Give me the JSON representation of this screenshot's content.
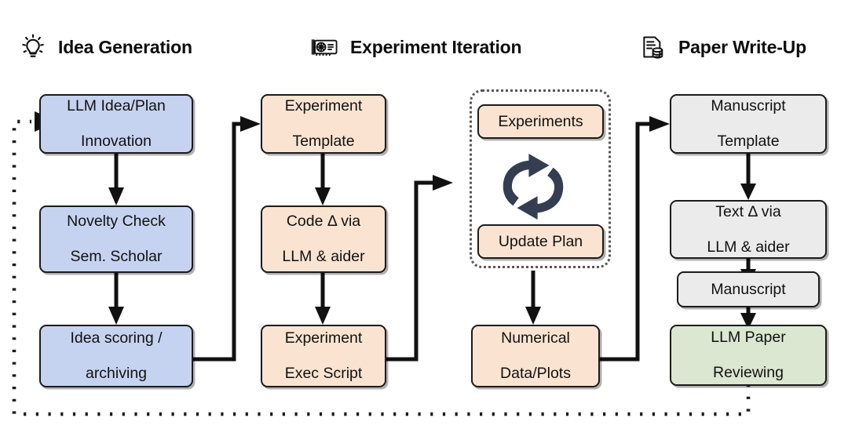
{
  "diagram": {
    "title": "AI Scientist pipeline",
    "type": "flowchart",
    "palette": {
      "blue": "#c6d3f0",
      "peach": "#fae4d1",
      "grey": "#ebebeb",
      "green": "#dbe7d1",
      "stroke": "#1b1b1b",
      "loop_icon": "#353d52",
      "dotted": "#555555"
    }
  },
  "headers": [
    {
      "id": "idea-generation",
      "label": "Idea Generation",
      "icon": "lightbulb-icon"
    },
    {
      "id": "experiment-iteration",
      "label": "Experiment Iteration",
      "icon": "gpu-card-icon"
    },
    {
      "id": "paper-write-up",
      "label": "Paper Write-Up",
      "icon": "document-database-icon"
    }
  ],
  "columns": [
    {
      "id": "idea-generation",
      "color": "blue",
      "nodes": [
        {
          "id": "llm-idea-plan",
          "line1": "LLM Idea/Plan",
          "line2": "Innovation"
        },
        {
          "id": "novelty-check",
          "line1": "Novelty Check",
          "line2": "Sem. Scholar"
        },
        {
          "id": "idea-scoring",
          "line1": "Idea scoring /",
          "line2": "archiving"
        }
      ]
    },
    {
      "id": "experiment-setup",
      "color": "peach",
      "nodes": [
        {
          "id": "experiment-template",
          "line1": "Experiment",
          "line2": "Template"
        },
        {
          "id": "code-delta",
          "line1": "Code Δ via",
          "line2": "LLM & aider"
        },
        {
          "id": "experiment-exec-script",
          "line1": "Experiment",
          "line2": "Exec Script"
        }
      ]
    },
    {
      "id": "experiment-loop",
      "color": "peach",
      "nodes": [
        {
          "id": "experiments",
          "line1": "Experiments",
          "line2": ""
        },
        {
          "id": "update-plan",
          "line1": "Update Plan",
          "line2": ""
        },
        {
          "id": "numerical-data-plots",
          "line1": "Numerical",
          "line2": "Data/Plots"
        }
      ],
      "loop_icon": "refresh-cycle-icon"
    },
    {
      "id": "paper-write-up",
      "color": "grey",
      "nodes": [
        {
          "id": "manuscript-template",
          "line1": "Manuscript",
          "line2": "Template",
          "color": "grey"
        },
        {
          "id": "text-delta",
          "line1": "Text Δ via",
          "line2": "LLM & aider",
          "color": "grey"
        },
        {
          "id": "manuscript",
          "line1": "Manuscript",
          "line2": "",
          "color": "grey"
        },
        {
          "id": "llm-paper-reviewing",
          "line1": "LLM Paper",
          "line2": "Reviewing",
          "color": "green"
        }
      ]
    }
  ],
  "connections": [
    {
      "from": "feedback-loop",
      "to": "llm-idea-plan",
      "style": "dotted-arrow"
    },
    {
      "from": "llm-idea-plan",
      "to": "novelty-check",
      "style": "arrow"
    },
    {
      "from": "novelty-check",
      "to": "idea-scoring",
      "style": "arrow"
    },
    {
      "from": "idea-scoring",
      "to": "experiment-template",
      "style": "elbow-arrow"
    },
    {
      "from": "experiment-template",
      "to": "code-delta",
      "style": "arrow"
    },
    {
      "from": "code-delta",
      "to": "experiment-exec-script",
      "style": "arrow"
    },
    {
      "from": "experiment-exec-script",
      "to": "experiment-loop",
      "style": "elbow-arrow"
    },
    {
      "from": "experiment-loop",
      "to": "numerical-data-plots",
      "style": "arrow"
    },
    {
      "from": "numerical-data-plots",
      "to": "manuscript-template",
      "style": "elbow-arrow"
    },
    {
      "from": "manuscript-template",
      "to": "text-delta",
      "style": "arrow"
    },
    {
      "from": "text-delta",
      "to": "manuscript",
      "style": "arrow"
    },
    {
      "from": "manuscript",
      "to": "llm-paper-reviewing",
      "style": "arrow"
    },
    {
      "from": "llm-paper-reviewing",
      "to": "llm-idea-plan",
      "style": "dotted-feedback"
    }
  ]
}
